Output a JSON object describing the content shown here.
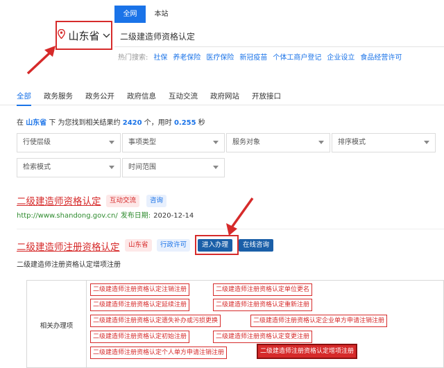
{
  "scope_tabs": [
    {
      "label": "全网",
      "active": true
    },
    {
      "label": "本站",
      "active": false
    }
  ],
  "region": {
    "icon": "location-pin-icon",
    "label": "山东省",
    "chevron": "chevron-down-icon"
  },
  "search": {
    "query": "二级建造师资格认定"
  },
  "hot_search": {
    "label": "热门搜索:",
    "links": [
      "社保",
      "养老保险",
      "医疗保险",
      "新冠疫苗",
      "个体工商户登记",
      "企业设立",
      "食品经营许可"
    ]
  },
  "category_tabs": [
    {
      "label": "全部",
      "active": true
    },
    {
      "label": "政务服务",
      "active": false
    },
    {
      "label": "政务公开",
      "active": false
    },
    {
      "label": "政府信息",
      "active": false
    },
    {
      "label": "互动交流",
      "active": false
    },
    {
      "label": "政府网站",
      "active": false
    },
    {
      "label": "开放接口",
      "active": false
    }
  ],
  "summary": {
    "p1": "在 ",
    "region": "山东省",
    "p2": " 下 为您找到相关结果约 ",
    "count": "2420",
    "p3": " 个，用时 ",
    "time": "0.255",
    "p4": " 秒"
  },
  "filters": [
    "行使层级",
    "事项类型",
    "服务对象",
    "排序模式",
    "检索模式",
    "时间范围"
  ],
  "result1": {
    "title": "二级建造师资格认定",
    "tags": [
      "互动交流",
      "咨询"
    ],
    "url": "http://www.shandong.gov.cn/",
    "date_label": "发布日期:",
    "date": "2020-12-14"
  },
  "result2": {
    "title": "二级建造师注册资格认定",
    "tags": [
      "山东省",
      "行政许可"
    ],
    "buttons": [
      "进入办理",
      "在线咨询"
    ],
    "subtitle": "二级建造师注册资格认定增项注册"
  },
  "related": {
    "label": "相关办理项",
    "items": [
      "二级建造师注册资格认定注销注册",
      "二级建造师注册资格认定单位更名",
      "二级建造师注册资格认定延续注册",
      "二级建造师注册资格认定重新注册",
      "二级建造师注册资格认定遗失补办或污损更换",
      "二级建造师注册资格认定企业单方申请注销注册",
      "二级建造师注册资格认定初始注册",
      "二级建造师注册资格认定变更注册",
      "二级建造师注册资格认定个人单方申请注销注册",
      "二级建造师注册资格认定增项注册"
    ],
    "active_index": 9
  },
  "colors": {
    "accent": "#1a73e8",
    "highlight_red": "#d62a2a",
    "button_blue": "#1a5fa8",
    "url_green": "#2e8b2e"
  }
}
